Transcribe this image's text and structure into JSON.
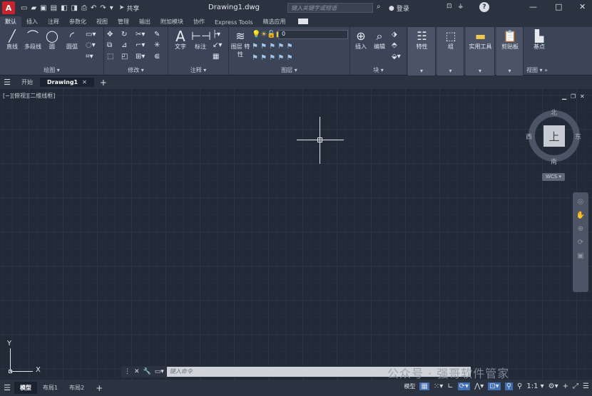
{
  "app": {
    "logo": "A",
    "doc_title": "Drawing1.dwg",
    "share_label": "共享",
    "search_placeholder": "键入关键字或短语",
    "login_label": "登录",
    "help_glyph": "?"
  },
  "ribbon_tabs": [
    "默认",
    "插入",
    "注释",
    "参数化",
    "视图",
    "管理",
    "输出",
    "附加模块",
    "协作",
    "Express Tools",
    "精选应用"
  ],
  "panels": {
    "draw": {
      "title": "绘图 ▾",
      "tools": [
        "直线",
        "多段线",
        "圆",
        "圆弧"
      ]
    },
    "modify": {
      "title": "修改 ▾"
    },
    "annotation": {
      "title": "注释 ▾",
      "tools": [
        "文字",
        "标注"
      ]
    },
    "layers": {
      "title": "图层 ▾",
      "layer_props": "图层\n特性",
      "current_layer": "0"
    },
    "block": {
      "title": "块 ▾",
      "tools": [
        "插入",
        "编辑"
      ]
    },
    "properties": {
      "tool": "特性"
    },
    "groups": {
      "tool": "组"
    },
    "utilities": {
      "tool": "实用工具"
    },
    "clipboard": {
      "tool": "剪贴板"
    },
    "view": {
      "tool": "基点",
      "title": "视图 ▾ »"
    }
  },
  "doc_tabs": {
    "start": "开始",
    "drawing": "Drawing1"
  },
  "viewport": {
    "label": "[−][俯视][二维线框]",
    "viewcube": {
      "north": "北",
      "south": "南",
      "east": "东",
      "west": "西",
      "top": "上",
      "wcs": "WCS ▾"
    },
    "ucs": {
      "x": "X",
      "y": "Y"
    }
  },
  "command": {
    "placeholder": "键入命令"
  },
  "watermark": "公众号 · 强哥软件管家",
  "status": {
    "tabs": [
      "模型",
      "布局1",
      "布局2"
    ],
    "model_label": "模型",
    "scale": "1:1 ▾"
  }
}
